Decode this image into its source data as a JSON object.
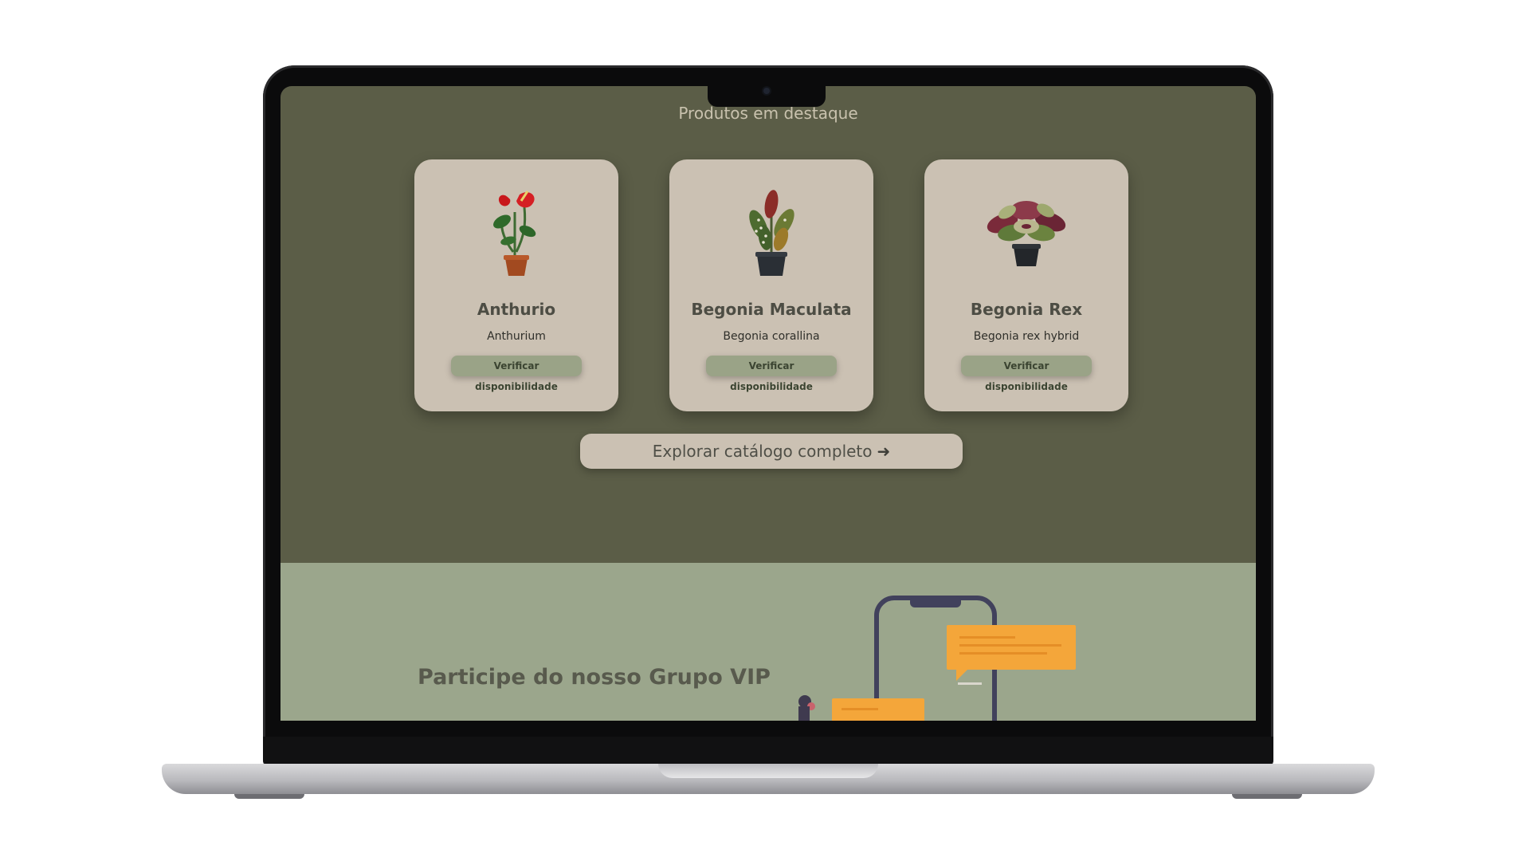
{
  "section_title": "Produtos em destaque",
  "products": [
    {
      "name": "Anthurio",
      "scientific_name": "Anthurium",
      "button_label": "Verificar disponibilidade",
      "image_icon": "potted-anthurium"
    },
    {
      "name": "Begonia Maculata",
      "scientific_name": "Begonia corallina",
      "button_label": "Verificar disponibilidade",
      "image_icon": "potted-begonia-maculata"
    },
    {
      "name": "Begonia Rex",
      "scientific_name": "Begonia rex hybrid",
      "button_label": "Verificar disponibilidade",
      "image_icon": "potted-begonia-rex"
    }
  ],
  "explore_button": {
    "label": "Explorar catálogo completo",
    "arrow_icon": "arrow-right-icon"
  },
  "vip_section": {
    "title": "Participe do nosso Grupo VIP",
    "illustration_icon": "phone-chat-illustration"
  },
  "colors": {
    "page_dark": "#5b5d47",
    "card_bg": "#cbc1b3",
    "card_button": "#9aa387",
    "vip_bg": "#9ba68c",
    "chat_bubble": "#f4a63a",
    "phone_outline": "#41415c"
  }
}
